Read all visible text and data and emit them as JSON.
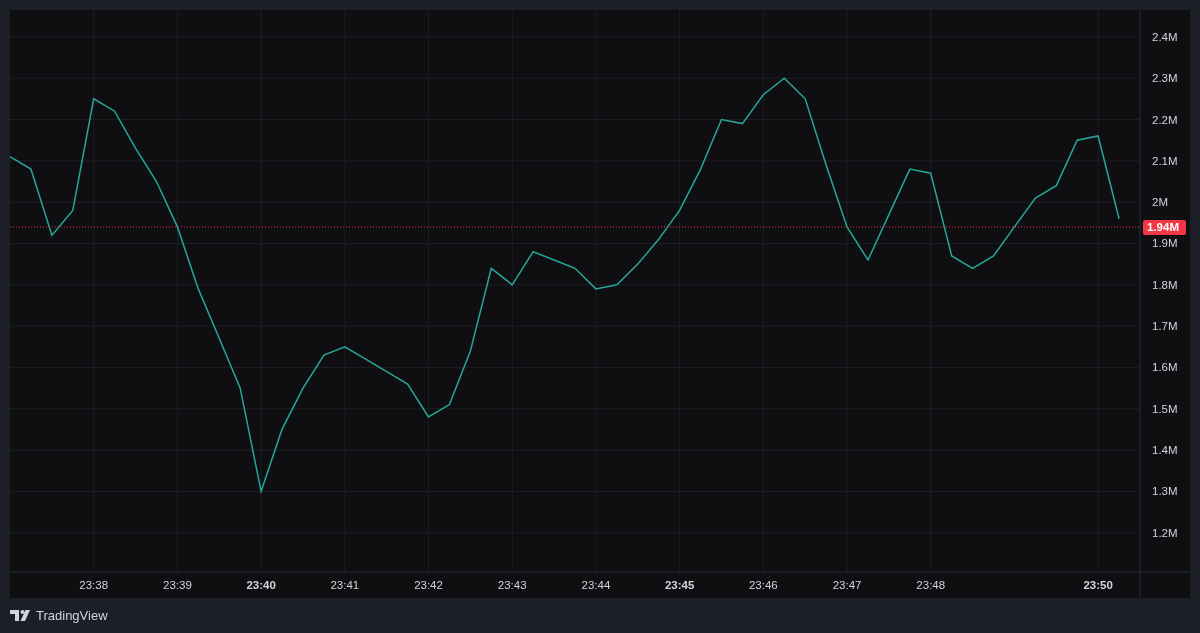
{
  "chart": {
    "chart_data": {
      "type": "line",
      "categories": [
        null,
        null,
        null,
        null,
        "23:38",
        null,
        null,
        null,
        "23:39",
        null,
        null,
        null,
        "23:40",
        null,
        null,
        null,
        "23:41",
        null,
        null,
        null,
        "23:42",
        null,
        null,
        null,
        "23:43",
        null,
        null,
        null,
        "23:44",
        null,
        null,
        null,
        "23:45",
        null,
        null,
        null,
        "23:46",
        null,
        null,
        null,
        "23:47",
        null,
        null,
        null,
        "23:48",
        null,
        null,
        null,
        null,
        null,
        null,
        null,
        "23:50",
        null
      ],
      "series": [
        {
          "color": "#26a69a",
          "values": [
            2.11,
            2.08,
            1.92,
            1.98,
            2.25,
            2.22,
            2.13,
            2.05,
            1.94,
            1.79,
            1.67,
            1.55,
            1.3,
            1.45,
            1.55,
            1.63,
            1.65,
            1.62,
            1.59,
            1.56,
            1.48,
            1.51,
            1.64,
            1.84,
            1.8,
            1.88,
            1.86,
            1.84,
            1.79,
            1.8,
            1.85,
            1.91,
            1.98,
            2.08,
            2.2,
            2.19,
            2.26,
            2.3,
            2.25,
            2.09,
            1.94,
            1.86,
            1.97,
            2.08,
            2.07,
            1.87,
            1.84,
            1.87,
            1.94,
            2.01,
            2.04,
            2.15,
            2.16,
            1.96
          ]
        }
      ],
      "ylim": [
        1.105,
        2.465
      ],
      "yticks": [
        {
          "value": 2.4,
          "label": "2.4M"
        },
        {
          "value": 2.3,
          "label": "2.3M"
        },
        {
          "value": 2.2,
          "label": "2.2M"
        },
        {
          "value": 2.1,
          "label": "2.1M"
        },
        {
          "value": 2,
          "label": "2M"
        },
        {
          "value": 1.9,
          "label": "1.9M"
        },
        {
          "value": 1.8,
          "label": "1.8M"
        },
        {
          "value": 1.7,
          "label": "1.7M"
        },
        {
          "value": 1.6,
          "label": "1.6M"
        },
        {
          "value": 1.5,
          "label": "1.5M"
        },
        {
          "value": 1.4,
          "label": "1.4M"
        },
        {
          "value": 1.3,
          "label": "1.3M"
        },
        {
          "value": 1.2,
          "label": "1.2M"
        }
      ],
      "grid": true,
      "ref_lines": [
        {
          "axis": "y",
          "value": 1.94,
          "label": "1.94M",
          "color": "#f23645"
        }
      ]
    }
  },
  "footer": {
    "brand": "TradingView"
  }
}
